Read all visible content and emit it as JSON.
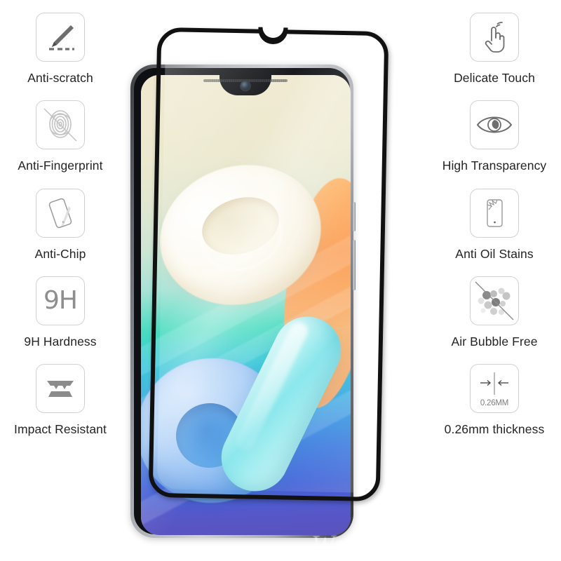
{
  "product": {
    "brand_watermark": "WolfRule",
    "watermark_symbol": "®",
    "device_type": "smartphone",
    "accessory_type": "tempered glass screen protector"
  },
  "features_left": [
    {
      "id": "anti-scratch",
      "icon": "pencil-scratch-icon",
      "label": "Anti-scratch"
    },
    {
      "id": "anti-fingerprint",
      "icon": "fingerprint-slash-icon",
      "label": "Anti-Fingerprint"
    },
    {
      "id": "anti-chip",
      "icon": "tilted-phone-icon",
      "label": "Anti-Chip"
    },
    {
      "id": "9h-hardness",
      "icon": "hardness-9h-icon",
      "label": "9H Hardness",
      "icon_text": "9H"
    },
    {
      "id": "impact-resistant",
      "icon": "impact-layers-icon",
      "label": "Impact Resistant"
    }
  ],
  "features_right": [
    {
      "id": "delicate-touch",
      "icon": "touch-hand-icon",
      "label": "Delicate Touch"
    },
    {
      "id": "high-transparency",
      "icon": "eye-icon",
      "label": "High Transparency"
    },
    {
      "id": "anti-oil-stains",
      "icon": "cracked-phone-icon",
      "label": "Anti Oil Stains"
    },
    {
      "id": "air-bubble-free",
      "icon": "bubbles-slash-icon",
      "label": "Air Bubble Free"
    },
    {
      "id": "thickness",
      "icon": "thickness-arrows-icon",
      "label": "0.26mm thickness",
      "icon_text": "0.26MM"
    }
  ],
  "colors": {
    "icon_border": "#d2d2d2",
    "icon_glyph": "#6e6e6e",
    "label_text": "#242424",
    "protector_frame": "#111111",
    "background": "#ffffff"
  }
}
